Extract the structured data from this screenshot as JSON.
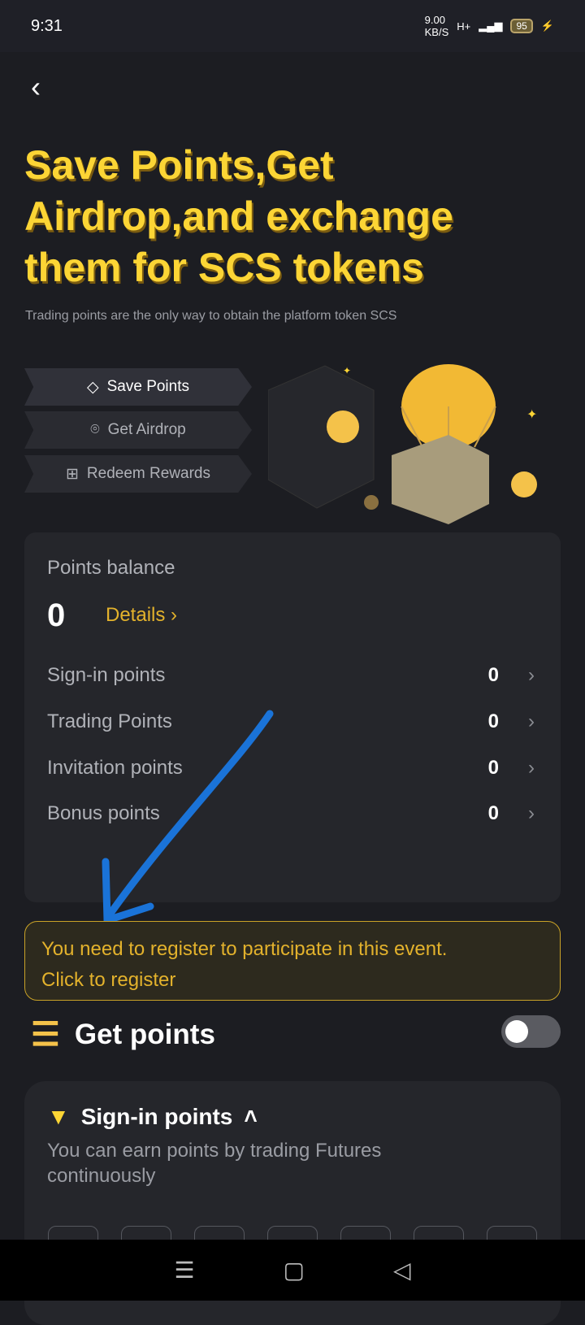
{
  "status": {
    "time": "9:31",
    "net_speed": "9.00",
    "net_unit": "KB/S",
    "network": "H+",
    "battery": "95"
  },
  "title": "Save Points,Get Airdrop,and exchange them for SCS tokens",
  "subtitle": "Trading points are the only way to obtain the platform token SCS",
  "tabs": [
    {
      "label": "Save Points"
    },
    {
      "label": "Get Airdrop"
    },
    {
      "label": "Redeem Rewards"
    }
  ],
  "balance": {
    "label": "Points balance",
    "value": "0",
    "details": "Details",
    "rows": [
      {
        "label": "Sign-in points",
        "value": "0"
      },
      {
        "label": "Trading Points",
        "value": "0"
      },
      {
        "label": "Invitation points",
        "value": "0"
      },
      {
        "label": "Bonus points",
        "value": "0"
      }
    ]
  },
  "notice": {
    "line1": "You need to register to participate in this event.",
    "line2": "Click to register"
  },
  "get_points": {
    "title": "Get points"
  },
  "signin": {
    "title": "Sign-in points",
    "desc": "You can earn points by trading Futures continuously"
  },
  "colors": {
    "accent": "#fcd535",
    "bg": "#1c1d22",
    "card": "#25262b"
  }
}
